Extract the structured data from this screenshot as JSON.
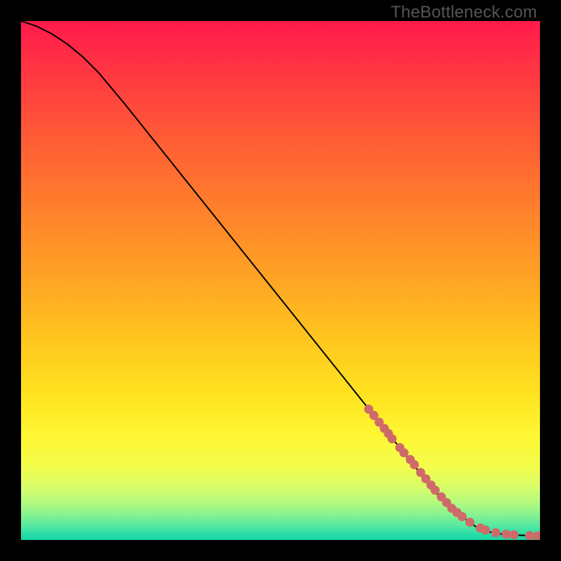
{
  "watermark": "TheBottleneck.com",
  "chart_data": {
    "type": "line",
    "title": "",
    "xlabel": "",
    "ylabel": "",
    "xlim": [
      0,
      100
    ],
    "ylim": [
      0,
      100
    ],
    "grid": false,
    "legend": false,
    "series": [
      {
        "name": "curve",
        "style": "line",
        "color": "#000000",
        "x": [
          0,
          3,
          6,
          9,
          12,
          15,
          20,
          30,
          40,
          50,
          60,
          70,
          80,
          85,
          88,
          90,
          92,
          94,
          96,
          98,
          100
        ],
        "y": [
          100,
          99,
          97.5,
          95.5,
          93,
          90,
          84,
          71.5,
          59,
          46.5,
          34,
          21.5,
          9,
          4.5,
          2.3,
          1.6,
          1.2,
          1.0,
          0.9,
          0.85,
          0.8
        ]
      },
      {
        "name": "highlight-points",
        "style": "scatter",
        "color": "#cf6a6a",
        "x": [
          67,
          68,
          69,
          70,
          70.8,
          71.5,
          73,
          73.8,
          75,
          75.8,
          77,
          78,
          79,
          79.8,
          81,
          82,
          83,
          84,
          85,
          86.5,
          88.5,
          89.5,
          91.5,
          93.5,
          95,
          98,
          99.5
        ],
        "y": [
          25.2,
          24,
          22.7,
          21.5,
          20.5,
          19.5,
          17.8,
          16.8,
          15.5,
          14.5,
          13,
          11.8,
          10.6,
          9.6,
          8.3,
          7.2,
          6.1,
          5.3,
          4.5,
          3.4,
          2.3,
          1.9,
          1.4,
          1.1,
          1.0,
          0.85,
          0.8
        ]
      }
    ],
    "background_gradient": {
      "type": "vertical",
      "stops": [
        {
          "pos": 0.0,
          "color": "#ff1a4b"
        },
        {
          "pos": 0.1,
          "color": "#ff3742"
        },
        {
          "pos": 0.22,
          "color": "#ff5a36"
        },
        {
          "pos": 0.35,
          "color": "#ff7d2c"
        },
        {
          "pos": 0.48,
          "color": "#ff9f25"
        },
        {
          "pos": 0.6,
          "color": "#ffc21f"
        },
        {
          "pos": 0.72,
          "color": "#ffe31f"
        },
        {
          "pos": 0.8,
          "color": "#fef733"
        },
        {
          "pos": 0.86,
          "color": "#f3fd4d"
        },
        {
          "pos": 0.9,
          "color": "#d7fd6a"
        },
        {
          "pos": 0.93,
          "color": "#b0f97f"
        },
        {
          "pos": 0.955,
          "color": "#7ef193"
        },
        {
          "pos": 0.975,
          "color": "#4fe7a2"
        },
        {
          "pos": 0.99,
          "color": "#26dca8"
        },
        {
          "pos": 1.0,
          "color": "#17d7a6"
        }
      ]
    }
  }
}
